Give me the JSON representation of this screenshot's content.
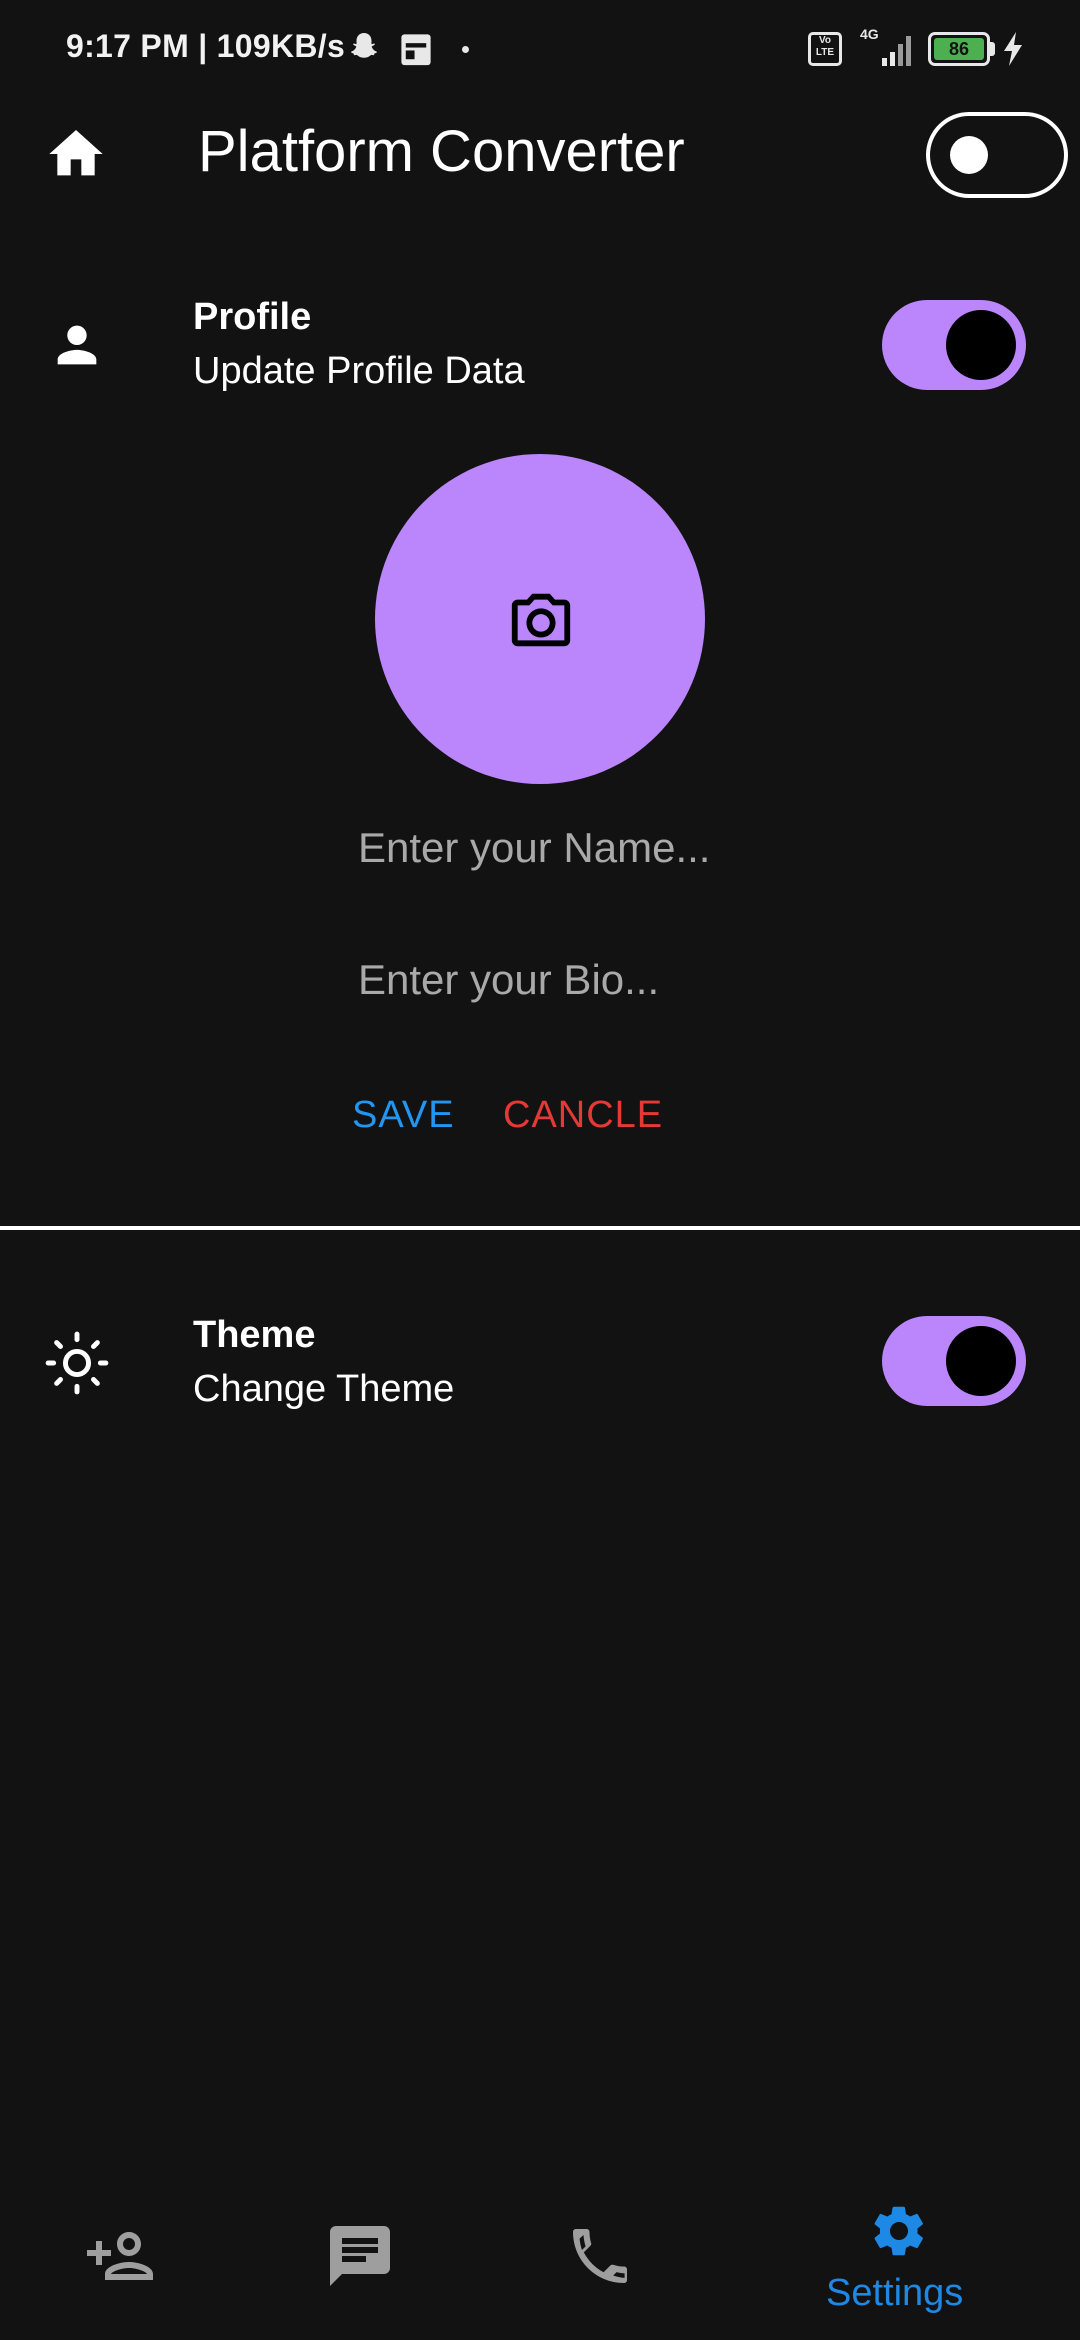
{
  "status_bar": {
    "text": "9:17 PM | 109KB/s",
    "battery": "86",
    "network": "4G"
  },
  "app_bar": {
    "title": "Platform Converter",
    "home_icon": "home-icon",
    "mode_toggle_on": false
  },
  "profile": {
    "icon": "person-icon",
    "title": "Profile",
    "subtitle": "Update Profile Data",
    "switch_on": true,
    "avatar_icon": "camera-icon",
    "name_placeholder": "Enter your Name...",
    "bio_placeholder": "Enter your Bio...",
    "save_label": "SAVE",
    "cancel_label": "CANCLE"
  },
  "theme": {
    "icon": "brightness-icon",
    "title": "Theme",
    "subtitle": "Change Theme",
    "switch_on": true
  },
  "bottom_nav": {
    "items": [
      {
        "icon": "add-person-icon",
        "label": ""
      },
      {
        "icon": "chat-icon",
        "label": ""
      },
      {
        "icon": "phone-icon",
        "label": ""
      },
      {
        "icon": "gear-icon",
        "label": "Settings"
      }
    ]
  },
  "colors": {
    "background": "#121212",
    "accent_purple": "#bb86fc",
    "save_blue": "#2196f3",
    "cancel_red": "#e53935",
    "nav_active": "#1e88e5",
    "nav_inactive": "#9e9e9e"
  }
}
